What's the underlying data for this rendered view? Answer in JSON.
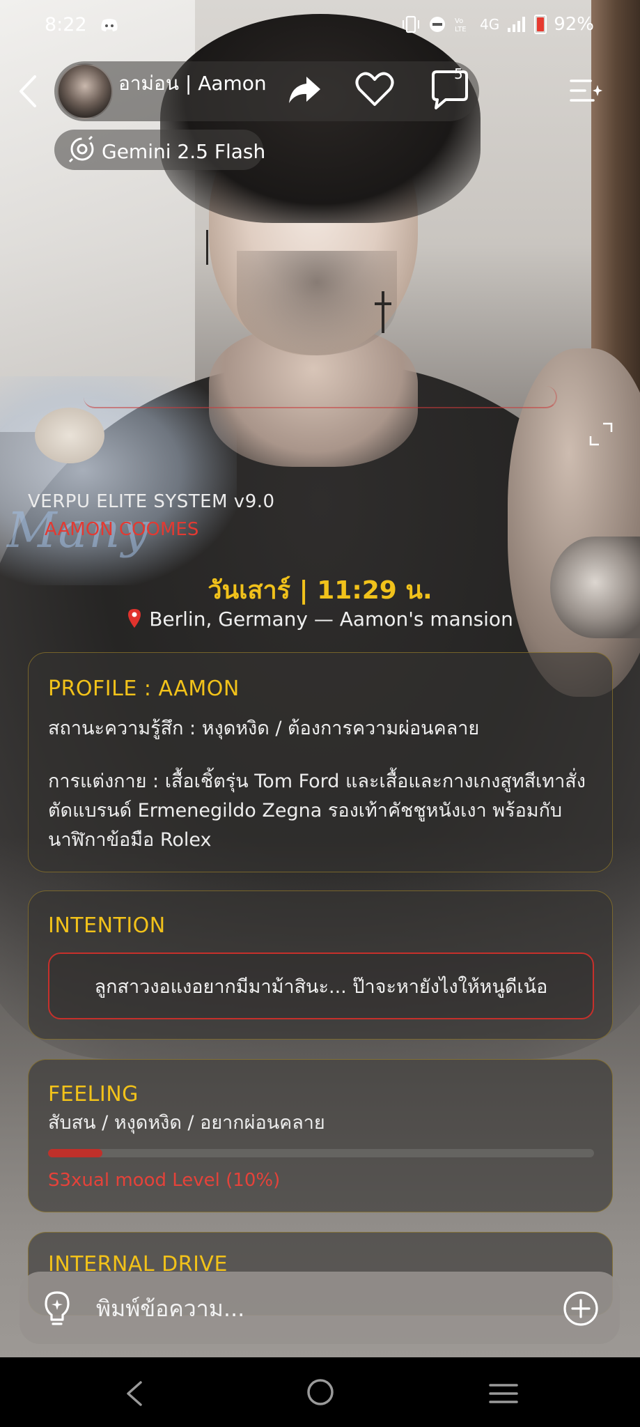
{
  "status_bar": {
    "time": "8:22",
    "battery": "92%",
    "icons": [
      "discord-icon",
      "vibrate-icon",
      "dnd-icon",
      "volte-icon",
      "4g-icon",
      "signal-icon",
      "battery-icon"
    ],
    "network": "4G",
    "volte": "Vo LTE"
  },
  "header": {
    "character_name": "อาม่อน | Aamon",
    "chat_count": "5",
    "model": "Gemini 2.5 Flash"
  },
  "overlay": {
    "system_title": "VERPU ELITE SYSTEM v9.0",
    "system_subtitle": "AAMON COOMES",
    "date_time": "วันเสาร์ | 11:29 น.",
    "location": "Berlin, Germany — Aamon's mansion"
  },
  "cards": {
    "profile": {
      "title": "PROFILE : AAMON",
      "status": "สถานะความรู้สึก : หงุดหงิด / ต้องการความผ่อนคลาย",
      "outfit": "การแต่งกาย : เสื้อเชิ้ตรุ่น Tom Ford และเสื้อและกางเกงสูทสีเทาสั่งตัดแบรนด์ Ermenegildo Zegna รองเท้าคัชชูหนังเงา พร้อมกับนาฬิกาข้อมือ Rolex"
    },
    "intention": {
      "title": "INTENTION",
      "text": "ลูกสาวงอแงอยากมีมาม้าสินะ... ป๊าจะหายังไงให้หนูดีเน้อ"
    },
    "feeling": {
      "title": "FEELING",
      "text": "สับสน / หงุดหงิด / อยากผ่อนคลาย",
      "mood_label": "S3xual mood Level (10%)",
      "mood_level": 0.1
    },
    "internal_drive": {
      "title": "INTERNAL DRIVE"
    }
  },
  "input": {
    "placeholder": "พิมพ์ข้อความ..."
  },
  "colors": {
    "accent_gold": "#f2c21a",
    "accent_red": "#e33a32",
    "text": "#ffffff"
  }
}
